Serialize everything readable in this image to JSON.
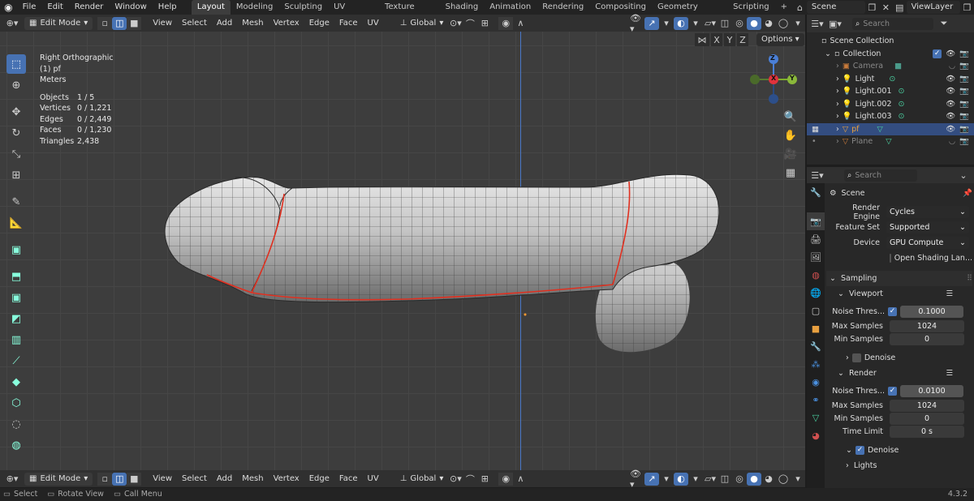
{
  "app": {
    "menu": [
      "File",
      "Edit",
      "Render",
      "Window",
      "Help"
    ],
    "workspaces": [
      "Layout",
      "Modeling",
      "Sculpting",
      "UV Editing",
      "Texture Paint",
      "Shading",
      "Animation",
      "Rendering",
      "Compositing",
      "Geometry Nodes",
      "Scripting"
    ],
    "active_workspace": "Layout",
    "add_workspace": "+",
    "scene_name": "Scene",
    "view_layer": "ViewLayer"
  },
  "viewport_header": {
    "mode": "Edit Mode",
    "menus": [
      "View",
      "Select",
      "Add",
      "Mesh",
      "Vertex",
      "Edge",
      "Face",
      "UV"
    ],
    "transform": "Global",
    "axis_buttons": [
      "X",
      "Y",
      "Z"
    ],
    "options": "Options"
  },
  "overlay": {
    "view_name": "Right Orthographic",
    "object_name": "(1) pf",
    "units": "Meters",
    "stats": [
      {
        "label": "Objects",
        "value": "1 / 5"
      },
      {
        "label": "Vertices",
        "value": "0 / 1,221"
      },
      {
        "label": "Edges",
        "value": "0 / 2,449"
      },
      {
        "label": "Faces",
        "value": "0 / 1,230"
      },
      {
        "label": "Triangles",
        "value": "2,438"
      }
    ]
  },
  "gizmo": {
    "z": "Z",
    "y": "Y",
    "x": "X"
  },
  "outliner": {
    "search_placeholder": "Search",
    "root": "Scene Collection",
    "collection": "Collection",
    "items": [
      {
        "name": "Camera",
        "dim": true
      },
      {
        "name": "Light",
        "dim": false
      },
      {
        "name": "Light.001",
        "dim": false
      },
      {
        "name": "Light.002",
        "dim": false
      },
      {
        "name": "Light.003",
        "dim": false
      },
      {
        "name": "pf",
        "dim": false,
        "selected": true
      },
      {
        "name": "Plane",
        "dim": true
      }
    ]
  },
  "properties": {
    "search_placeholder": "Search",
    "context": "Scene",
    "render_engine_label": "Render Engine",
    "render_engine": "Cycles",
    "feature_set_label": "Feature Set",
    "feature_set": "Supported",
    "device_label": "Device",
    "device": "GPU Compute",
    "open_shading": "Open Shading Lan...",
    "sampling": "Sampling",
    "viewport": {
      "title": "Viewport",
      "noise_label": "Noise Thres...",
      "noise": "0.1000",
      "max_label": "Max Samples",
      "max": "1024",
      "min_label": "Min Samples",
      "min": "0",
      "denoise": "Denoise"
    },
    "render": {
      "title": "Render",
      "noise_label": "Noise Thres...",
      "noise": "0.0100",
      "max_label": "Max Samples",
      "max": "1024",
      "min_label": "Min Samples",
      "min": "0",
      "time_label": "Time Limit",
      "time": "0 s",
      "denoise": "Denoise"
    },
    "lights": "Lights"
  },
  "bottom_header": {
    "mode": "Edit Mode",
    "menus": [
      "View",
      "Select",
      "Add",
      "Mesh",
      "Vertex",
      "Edge",
      "Face",
      "UV"
    ],
    "transform": "Global"
  },
  "status": {
    "select": "Select",
    "rotate": "Rotate View",
    "call_menu": "Call Menu",
    "version": "4.3.2"
  }
}
